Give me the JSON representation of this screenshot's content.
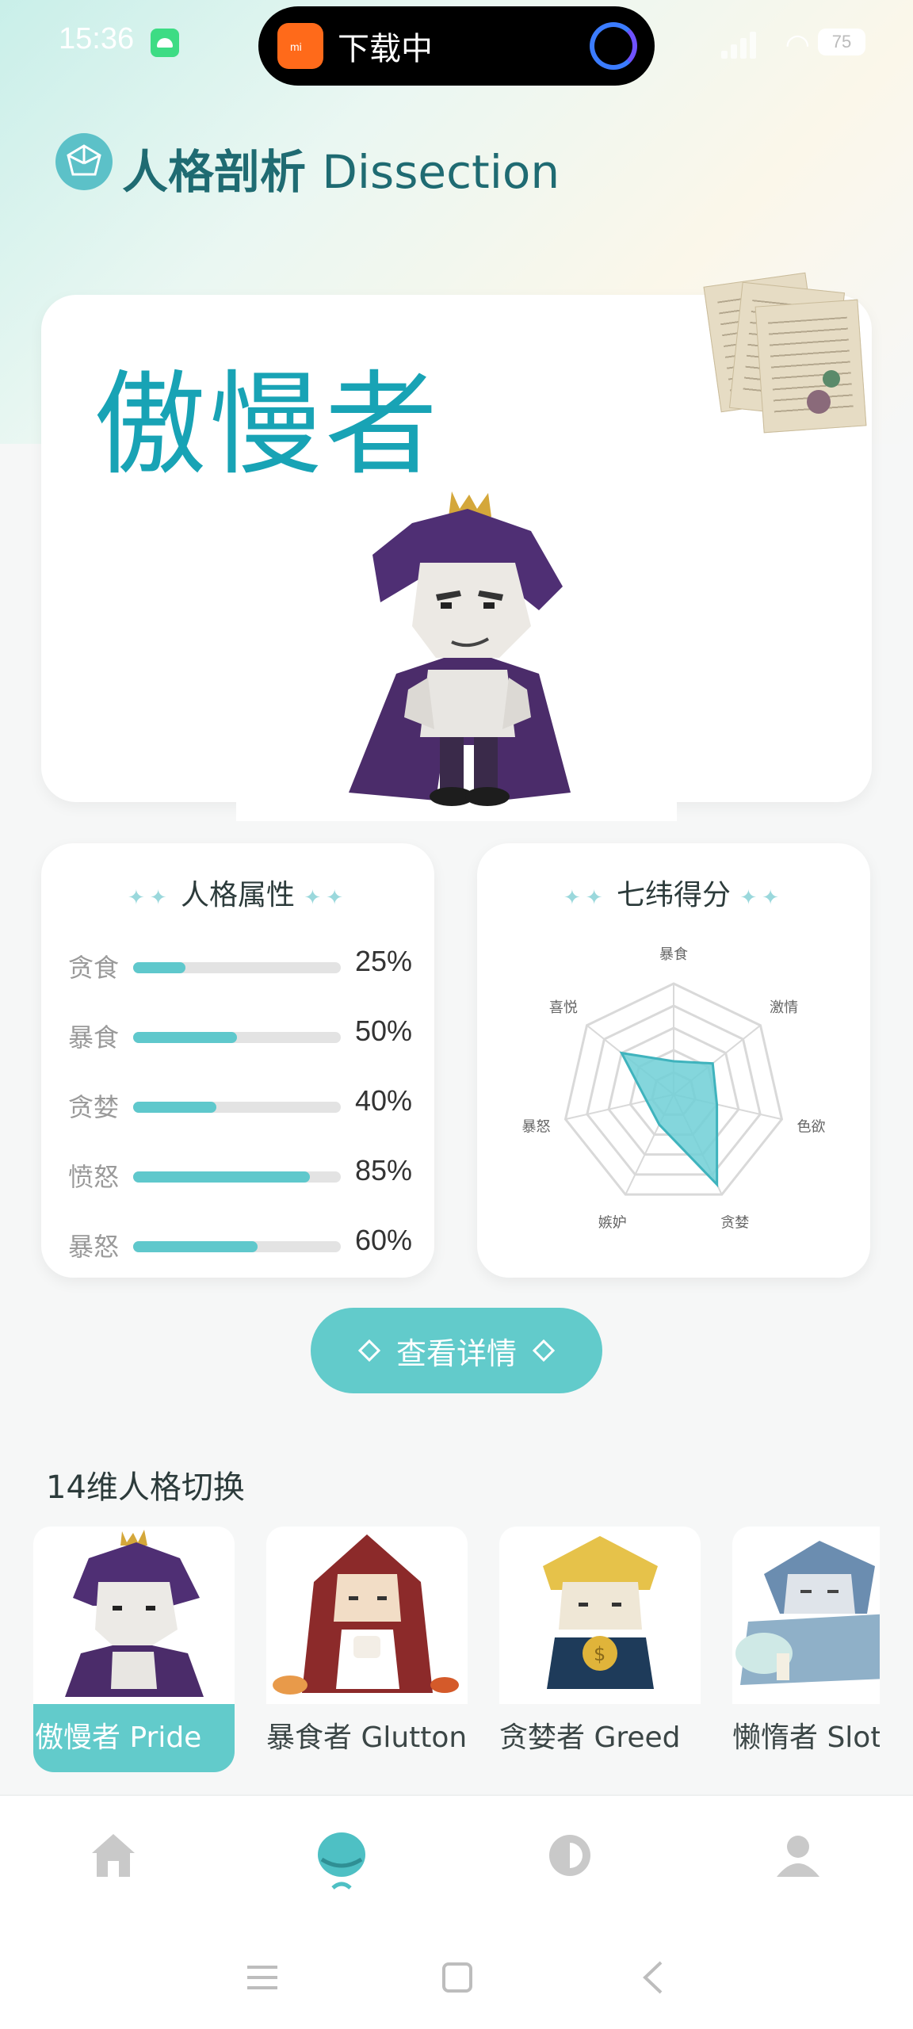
{
  "status_bar": {
    "time": "15:36",
    "download_text": "下载中",
    "battery": "75"
  },
  "header": {
    "title_cn": "人格剖析",
    "title_en": "Dissection"
  },
  "hero": {
    "name": "傲慢者"
  },
  "attributes": {
    "title": "人格属性",
    "items": [
      {
        "label": "贪食",
        "value": "25%",
        "percent": 25
      },
      {
        "label": "暴食",
        "value": "50%",
        "percent": 50
      },
      {
        "label": "贪婪",
        "value": "40%",
        "percent": 40
      },
      {
        "label": "愤怒",
        "value": "85%",
        "percent": 85
      },
      {
        "label": "暴怒",
        "value": "60%",
        "percent": 60
      }
    ]
  },
  "radar": {
    "title": "七纬得分",
    "axes": [
      "暴食",
      "激情",
      "色欲",
      "贪婪",
      "嫉妒",
      "暴怒",
      "喜悦"
    ],
    "values": [
      0.3,
      0.45,
      0.4,
      0.9,
      0.3,
      0.25,
      0.6
    ],
    "fill_color": "#6fcfd6"
  },
  "detail_button": {
    "label": "查看详情"
  },
  "switcher": {
    "title": "14维人格切换",
    "items": [
      {
        "label": "傲慢者  Pride",
        "active": true
      },
      {
        "label": "暴食者  Glutton",
        "active": false
      },
      {
        "label": "贪婪者  Greed",
        "active": false
      },
      {
        "label": "懒惰者  Sloth",
        "active": false
      }
    ]
  },
  "colors": {
    "accent": "#62cbcb",
    "title": "#18a3b5",
    "header": "#1f6b72"
  },
  "bottom_nav": {
    "items": [
      "home-icon",
      "persona-icon",
      "contrast-icon",
      "profile-icon"
    ],
    "active": "persona-icon"
  }
}
